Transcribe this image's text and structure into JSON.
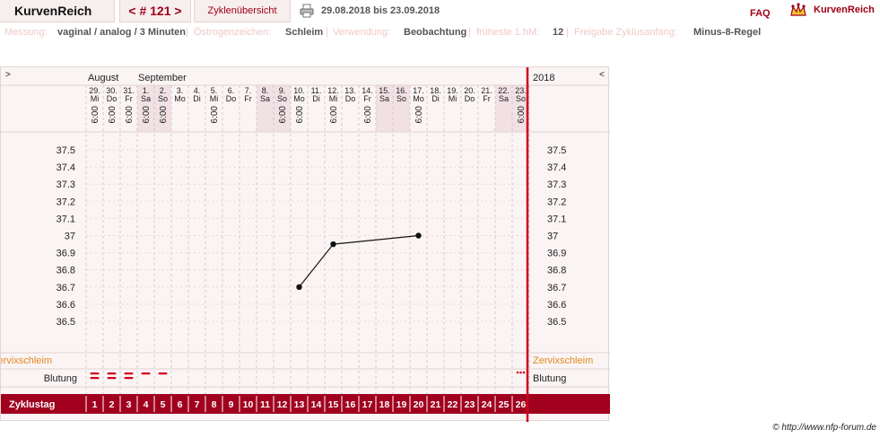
{
  "app": {
    "title": "KurvenReich"
  },
  "nav": {
    "prev": "<",
    "label": "# 121",
    "next": ">"
  },
  "toolbar": {
    "cycle_overview": "Zyklenübersicht",
    "print_icon": "printer-icon",
    "date_range": "29.08.2018 bis 23.09.2018",
    "faq": "FAQ",
    "logo_text": "KurvenReich",
    "logo_icon": "crown-icon"
  },
  "meta": {
    "measurement_label": "Messung:",
    "measurement_value": "vaginal / analog / 3 Minuten",
    "estrogen_label": "Östrogenzeichen:",
    "estrogen_value": "Schleim",
    "usage_label": "Verwendung:",
    "usage_value": "Beobachtung",
    "earliest_label": "früheste 1.hM:",
    "earliest_value": "12",
    "release_label": "Freigabe Zyklusanfang:",
    "release_value": "Minus-8-Regel",
    "separator": "|"
  },
  "chart_header": {
    "left_arrow": ">",
    "right_arrow": "<",
    "year": "2018",
    "month1": "August",
    "month2": "September"
  },
  "chart_data": {
    "type": "line",
    "days": [
      {
        "date": "29.",
        "weekday": "Mi",
        "time": "6:00",
        "weekend": false
      },
      {
        "date": "30.",
        "weekday": "Do",
        "time": "6:00",
        "weekend": false
      },
      {
        "date": "31.",
        "weekday": "Fr",
        "time": "6:00",
        "weekend": false
      },
      {
        "date": "1.",
        "weekday": "Sa",
        "time": "6:00",
        "weekend": true
      },
      {
        "date": "2.",
        "weekday": "So",
        "time": "6:00",
        "weekend": true
      },
      {
        "date": "3.",
        "weekday": "Mo",
        "time": "",
        "weekend": false
      },
      {
        "date": "4.",
        "weekday": "Di",
        "time": "",
        "weekend": false
      },
      {
        "date": "5.",
        "weekday": "Mi",
        "time": "6:00",
        "weekend": false
      },
      {
        "date": "6.",
        "weekday": "Do",
        "time": "",
        "weekend": false
      },
      {
        "date": "7.",
        "weekday": "Fr",
        "time": "",
        "weekend": false
      },
      {
        "date": "8.",
        "weekday": "Sa",
        "time": "",
        "weekend": true
      },
      {
        "date": "9.",
        "weekday": "So",
        "time": "6:00",
        "weekend": true
      },
      {
        "date": "10.",
        "weekday": "Mo",
        "time": "6:00",
        "weekend": false
      },
      {
        "date": "11.",
        "weekday": "Di",
        "time": "",
        "weekend": false
      },
      {
        "date": "12.",
        "weekday": "Mi",
        "time": "6:00",
        "weekend": false
      },
      {
        "date": "13.",
        "weekday": "Do",
        "time": "",
        "weekend": false
      },
      {
        "date": "14.",
        "weekday": "Fr",
        "time": "6:00",
        "weekend": false
      },
      {
        "date": "15.",
        "weekday": "Sa",
        "time": "",
        "weekend": true
      },
      {
        "date": "16.",
        "weekday": "So",
        "time": "",
        "weekend": true
      },
      {
        "date": "17.",
        "weekday": "Mo",
        "time": "6:00",
        "weekend": false
      },
      {
        "date": "18.",
        "weekday": "Di",
        "time": "",
        "weekend": false
      },
      {
        "date": "19.",
        "weekday": "Mi",
        "time": "",
        "weekend": false
      },
      {
        "date": "20.",
        "weekday": "Do",
        "time": "",
        "weekend": false
      },
      {
        "date": "21.",
        "weekday": "Fr",
        "time": "",
        "weekend": false
      },
      {
        "date": "22.",
        "weekday": "Sa",
        "time": "",
        "weekend": true
      },
      {
        "date": "23.",
        "weekday": "So",
        "time": "6:00",
        "weekend": true
      }
    ],
    "y_ticks": [
      "37.5",
      "37.4",
      "37.3",
      "37.2",
      "37.1",
      "37",
      "36.9",
      "36.8",
      "36.7",
      "36.6",
      "36.5"
    ],
    "ylim": [
      36.5,
      37.5
    ],
    "xlabel": "Zyklustag",
    "cycle_days": [
      "1",
      "2",
      "3",
      "4",
      "5",
      "6",
      "7",
      "8",
      "9",
      "10",
      "11",
      "12",
      "13",
      "14",
      "15",
      "16",
      "17",
      "18",
      "19",
      "20",
      "21",
      "22",
      "23",
      "24",
      "25",
      "26"
    ],
    "points": [
      {
        "cycle_day": 13,
        "temp": 36.7
      },
      {
        "cycle_day": 15,
        "temp": 36.95
      },
      {
        "cycle_day": 20,
        "temp": 37.0
      }
    ],
    "rows": {
      "mucus": "Zervixschleim",
      "bleeding": "Blutung"
    },
    "bleeding": [
      {
        "cycle_day": 1,
        "marks": 2
      },
      {
        "cycle_day": 2,
        "marks": 2
      },
      {
        "cycle_day": 3,
        "marks": 2
      },
      {
        "cycle_day": 4,
        "marks": 1
      },
      {
        "cycle_day": 5,
        "marks": 1
      },
      {
        "cycle_day": 26,
        "marks": 3
      }
    ],
    "colors": {
      "accent": "#a00018",
      "weekend_bg": "#f1e1e5",
      "mucus_label": "#e08a1e",
      "cycle_bar": "#a0001e"
    }
  },
  "footer": {
    "copyright": "© http://www.nfp-forum.de"
  }
}
